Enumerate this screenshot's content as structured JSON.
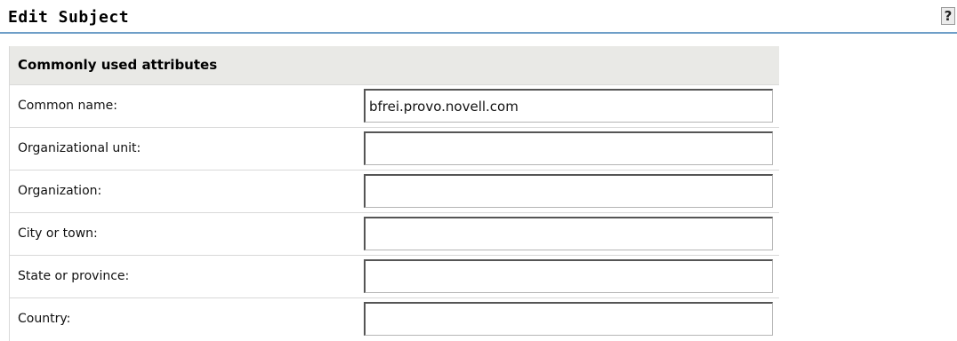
{
  "header": {
    "title": "Edit Subject",
    "help_label": "?"
  },
  "panel": {
    "title": "Commonly used attributes",
    "fields": [
      {
        "label": "Common name:",
        "value": "bfrei.provo.novell.com"
      },
      {
        "label": "Organizational unit:",
        "value": ""
      },
      {
        "label": "Organization:",
        "value": ""
      },
      {
        "label": "City or town:",
        "value": ""
      },
      {
        "label": "State or province:",
        "value": ""
      },
      {
        "label": "Country:",
        "value": ""
      }
    ]
  },
  "colors": {
    "title_underline": "#6e9ec8",
    "panel_header_bg": "#e9e9e6",
    "row_divider": "#d9d9d9"
  }
}
